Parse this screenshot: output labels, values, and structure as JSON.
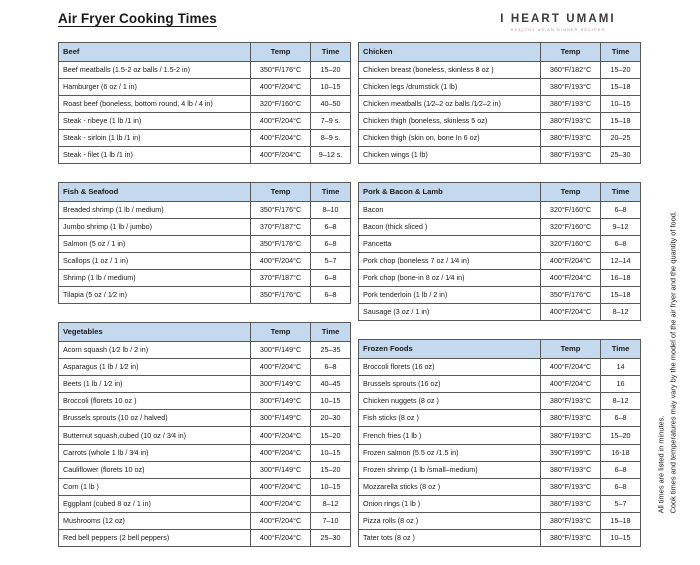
{
  "header": {
    "title": "Air Fryer Cooking Times",
    "brand_name": "I HEART UMAMI",
    "brand_tagline": "HEALTHY ASIAN DINNER RECIPES"
  },
  "columns": {
    "temp": "Temp",
    "time": "Time"
  },
  "notes": {
    "line1": "All times are listed in minutes.",
    "line2": "Cook times and temperatures may vary by the model of the air fryer and the quantity of food."
  },
  "colors": {
    "header_fill": "#c4d9ee",
    "border": "#595959",
    "brand_tagline": "#b07f88"
  },
  "tables": {
    "beef": {
      "category": "Beef",
      "rows": [
        {
          "item": "Beef meatballs (1.5-2 oz balls / 1.5-2 in)",
          "temp": "350°F/176°C",
          "time": "15–20"
        },
        {
          "item": "Hamburger (6 oz / 1 in)",
          "temp": "400°F/204°C",
          "time": "10–15"
        },
        {
          "item": "Roast beef (boneless, bottom round, 4 lb / 4 in)",
          "temp": "320°F/160°C",
          "time": "40–50"
        },
        {
          "item": "Steak - ribeye (1 lb /1 in)",
          "temp": "400°F/204°C",
          "time": "7–9 s."
        },
        {
          "item": "Steak - sirloin (1 lb /1 in)",
          "temp": "400°F/204°C",
          "time": "8–9 s."
        },
        {
          "item": "Steak - filet (1 lb /1 in)",
          "temp": "400°F/204°C",
          "time": "9–12 s."
        }
      ]
    },
    "fish": {
      "category": "Fish & Seafood",
      "rows": [
        {
          "item": "Breaded shrimp (1 lb / medium)",
          "temp": "350°F/176°C",
          "time": "8–10"
        },
        {
          "item": "Jumbo shrimp (1 lb / jumbo)",
          "temp": "370°F/187°C",
          "time": "6–8"
        },
        {
          "item": "Salmon (5 oz / 1 in)",
          "temp": "350°F/176°C",
          "time": "6–8"
        },
        {
          "item": "Scallops (1 oz / 1 in)",
          "temp": "400°F/204°C",
          "time": "5–7"
        },
        {
          "item": "Shrimp (1 lb / medium)",
          "temp": "370°F/187°C",
          "time": "6–8"
        },
        {
          "item": "Tilapia (5 oz / 1⁄2 in)",
          "temp": "350°F/176°C",
          "time": "6–8"
        }
      ]
    },
    "vegetables": {
      "category": "Vegetables",
      "rows": [
        {
          "item": "Acorn squash (1⁄2 lb / 2 in)",
          "temp": "300°F/149°C",
          "time": "25–35"
        },
        {
          "item": "Asparagus (1 lb / 1⁄2 in)",
          "temp": "400°F/204°C",
          "time": "6–8"
        },
        {
          "item": "Beets (1 lb / 1⁄2 in)",
          "temp": "300°F/149°C",
          "time": "40–45"
        },
        {
          "item": "Broccoli (florets 10 oz )",
          "temp": "300°F/149°C",
          "time": "10–15"
        },
        {
          "item": "Brussels sprouts (10 oz / halved)",
          "temp": "300°F/149°C",
          "time": "20–30"
        },
        {
          "item": "Butternut squash,cubed (10 oz / 3⁄4 in)",
          "temp": "400°F/204°C",
          "time": "15–20"
        },
        {
          "item": "Carrots (whole 1 lb / 3⁄4 in)",
          "temp": "400°F/204°C",
          "time": "10–15"
        },
        {
          "item": "Cauliflower (florets 10 oz)",
          "temp": "300°F/149°C",
          "time": "15–20"
        },
        {
          "item": "Corn (1 lb )",
          "temp": "400°F/204°C",
          "time": "10–15"
        },
        {
          "item": "Eggplant (cubed 8 oz / 1 in)",
          "temp": "400°F/204°C",
          "time": "8–12"
        },
        {
          "item": "Mushrooms (12 oz)",
          "temp": "400°F/204°C",
          "time": "7–10"
        },
        {
          "item": "Red bell peppers (2 bell peppers)",
          "temp": "400°F/204°C",
          "time": "25–30"
        }
      ]
    },
    "chicken": {
      "category": "Chicken",
      "rows": [
        {
          "item": "Chicken breast (boneless, skinless 8 oz )",
          "temp": "360°F/182°C",
          "time": "15–20"
        },
        {
          "item": "Chicken legs /drumstick (1 lb)",
          "temp": "380°F/193°C",
          "time": "15–18"
        },
        {
          "item": "Chicken meatballs (1⁄2–2 oz balls /1⁄2–2 in)",
          "temp": "380°F/193°C",
          "time": "10–15"
        },
        {
          "item": "Chicken thigh (boneless, skinless 5 oz)",
          "temp": "380°F/193°C",
          "time": "15–18"
        },
        {
          "item": "Chicken thigh (skin on, bone In 6 oz)",
          "temp": "380°F/193°C",
          "time": "20–25"
        },
        {
          "item": "Chicken wings (1 lb)",
          "temp": "380°F/193°C",
          "time": "25–30"
        }
      ]
    },
    "pork": {
      "category": "Pork & Bacon & Lamb",
      "rows": [
        {
          "item": "Bacon",
          "temp": "320°F/160°C",
          "time": "6–8"
        },
        {
          "item": "Bacon (thick sliced )",
          "temp": "320°F/160°C",
          "time": "9–12"
        },
        {
          "item": "Pancetta",
          "temp": "320°F/160°C",
          "time": "6–8"
        },
        {
          "item": "Pork chop (boneless 7 oz / 1⁄4 in)",
          "temp": "400°F/204°C",
          "time": "12–14"
        },
        {
          "item": "Pork chop (bone-in 8 oz / 1⁄4 in)",
          "temp": "400°F/204°C",
          "time": "16–18"
        },
        {
          "item": "Pork tenderloin (1 lb / 2 in)",
          "temp": "350°F/176°C",
          "time": "15–18"
        },
        {
          "item": "Sausage (3 oz / 1 in)",
          "temp": "400°F/204°C",
          "time": "8–12"
        }
      ]
    },
    "frozen": {
      "category": "Frozen Foods",
      "rows": [
        {
          "item": "Broccoli florets (16 oz)",
          "temp": "400°F/204°C",
          "time": "14"
        },
        {
          "item": "Brussels sprouts (16 oz)",
          "temp": "400°F/204°C",
          "time": "16"
        },
        {
          "item": "Chicken nuggets (8 oz )",
          "temp": "380°F/193°C",
          "time": "8–12"
        },
        {
          "item": "Fish sticks (8 oz )",
          "temp": "380°F/193°C",
          "time": "6–8"
        },
        {
          "item": "French fries (1 lb )",
          "temp": "380°F/193°C",
          "time": "15–20"
        },
        {
          "item": "Frozen salmon (5.5 oz /1.5 in)",
          "temp": "390°F/199°C",
          "time": "16-18"
        },
        {
          "item": "Frozen shrimp (1 lb /small–medium)",
          "temp": "380°F/193°C",
          "time": "6–8"
        },
        {
          "item": "Mozzarella sticks (8 oz )",
          "temp": "380°F/193°C",
          "time": "6–8"
        },
        {
          "item": "Onion rings (1 lb )",
          "temp": "380°F/193°C",
          "time": "5–7"
        },
        {
          "item": "Pizza rolls (8 oz )",
          "temp": "380°F/193°C",
          "time": "15–18"
        },
        {
          "item": "Tater tots (8 oz )",
          "temp": "380°F/193°C",
          "time": "10–15"
        }
      ]
    }
  }
}
